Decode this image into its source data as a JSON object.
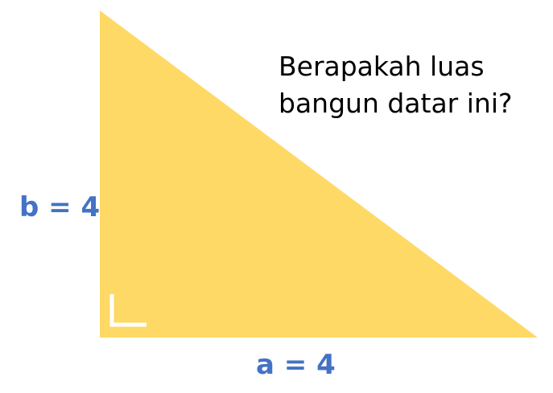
{
  "question": {
    "line1": "Berapakah luas",
    "line2": "bangun datar ini?"
  },
  "labels": {
    "b": "b = 4",
    "a": "a = 4"
  },
  "colors": {
    "triangle_fill": "#FFD966",
    "label_text": "#4472C4",
    "question_text": "#000000",
    "right_angle_marker": "#FFFFFF"
  },
  "shapes": {
    "triangle": "right-triangle",
    "marker": "right-angle-icon"
  }
}
